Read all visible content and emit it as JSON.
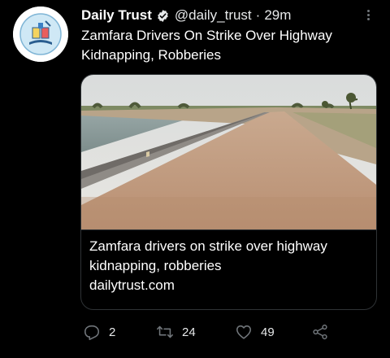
{
  "tweet": {
    "author_name": "Daily Trust",
    "handle": "@daily_trust",
    "separator": "·",
    "time": "29m",
    "text": "Zamfara Drivers On Strike Over Highway Kidnapping, Robberies",
    "icons": {
      "verified": "verified-badge-icon",
      "more": "more-vertical-icon",
      "reply": "reply-icon",
      "retweet": "retweet-icon",
      "like": "like-icon",
      "share": "share-icon"
    }
  },
  "card": {
    "title": "Zamfara drivers on strike over highway\nkidnapping, robberies",
    "domain": "dailytrust.com"
  },
  "actions": {
    "replies": "2",
    "retweets": "24",
    "likes": "49"
  },
  "colors": {
    "background": "#000000",
    "text": "#ffffff",
    "muted": "#71767b",
    "border": "#2f3336",
    "verified": "#e7e9ea"
  }
}
